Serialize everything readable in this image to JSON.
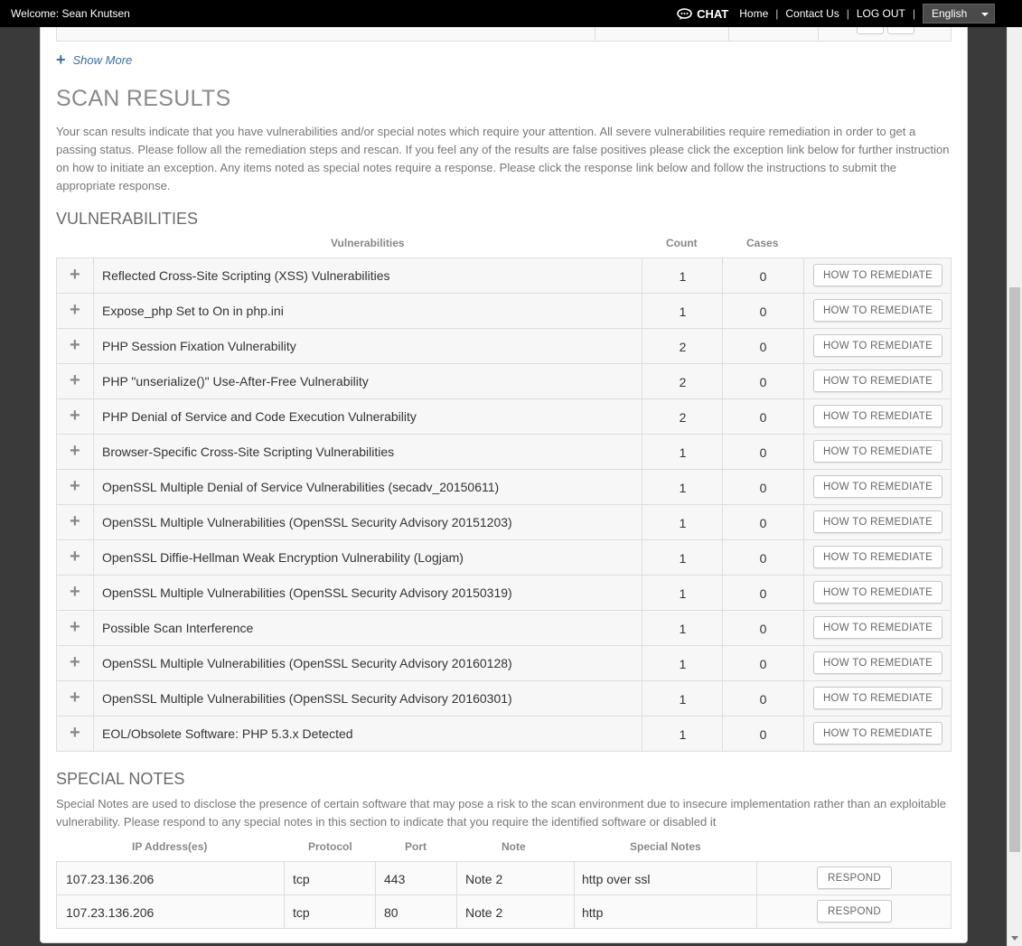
{
  "topbar": {
    "welcome": "Welcome: Sean Knutsen",
    "chat_label": "CHAT",
    "nav": {
      "home": "Home",
      "contact": "Contact Us",
      "logout": "LOG OUT",
      "separator": "|"
    },
    "language": "English"
  },
  "show_more": "Show More",
  "scan_results": {
    "title": "SCAN RESULTS",
    "description": "Your scan results indicate that you have vulnerabilities and/or special notes which require your attention. All severe vulnerabilities require remediation in order to get a passing status. Please follow all the remediation steps and rescan. If you feel any of the results are false positives please click the exception link below for further instruction on how to initiate an exception. Any items noted as special notes require a response. Please click the response link below and follow the instructions to submit the appropriate response."
  },
  "vulnerabilities": {
    "title": "VULNERABILITIES",
    "headers": {
      "name": "Vulnerabilities",
      "count": "Count",
      "cases": "Cases"
    },
    "button_label": "HOW TO REMEDIATE",
    "expand_glyph": "+",
    "rows": [
      {
        "name": "Reflected Cross-Site Scripting (XSS) Vulnerabilities",
        "count": "1",
        "cases": "0"
      },
      {
        "name": "Expose_php Set to On in php.ini",
        "count": "1",
        "cases": "0"
      },
      {
        "name": "PHP Session Fixation Vulnerability",
        "count": "2",
        "cases": "0"
      },
      {
        "name": "PHP \"unserialize()\" Use-After-Free Vulnerability",
        "count": "2",
        "cases": "0"
      },
      {
        "name": "PHP Denial of Service and Code Execution Vulnerability",
        "count": "2",
        "cases": "0"
      },
      {
        "name": "Browser-Specific Cross-Site Scripting Vulnerabilities",
        "count": "1",
        "cases": "0"
      },
      {
        "name": "OpenSSL Multiple Denial of Service Vulnerabilities (secadv_20150611)",
        "count": "1",
        "cases": "0"
      },
      {
        "name": "OpenSSL Multiple Vulnerabilities (OpenSSL Security Advisory 20151203)",
        "count": "1",
        "cases": "0"
      },
      {
        "name": "OpenSSL Diffie-Hellman Weak Encryption Vulnerability (Logjam)",
        "count": "1",
        "cases": "0"
      },
      {
        "name": "OpenSSL Multiple Vulnerabilities (OpenSSL Security Advisory 20150319)",
        "count": "1",
        "cases": "0"
      },
      {
        "name": "Possible Scan Interference",
        "count": "1",
        "cases": "0"
      },
      {
        "name": "OpenSSL Multiple Vulnerabilities (OpenSSL Security Advisory 20160128)",
        "count": "1",
        "cases": "0"
      },
      {
        "name": "OpenSSL Multiple Vulnerabilities (OpenSSL Security Advisory 20160301)",
        "count": "1",
        "cases": "0"
      },
      {
        "name": "EOL/Obsolete Software: PHP 5.3.x Detected",
        "count": "1",
        "cases": "0"
      }
    ]
  },
  "special_notes": {
    "title": "SPECIAL NOTES",
    "description": "Special Notes are used to disclose the presence of certain software that may pose a risk to the scan environment due to insecure implementation rather than an exploitable vulnerability. Please respond to any special notes in this section to indicate that you require the identified software or disabled it",
    "headers": {
      "ip": "IP Address(es)",
      "protocol": "Protocol",
      "port": "Port",
      "note": "Note",
      "special": "Special Notes"
    },
    "button_label": "RESPOND",
    "rows": [
      {
        "ip": "107.23.136.206",
        "protocol": "tcp",
        "port": "443",
        "note": "Note 2",
        "special": "http over ssl"
      },
      {
        "ip": "107.23.136.206",
        "protocol": "tcp",
        "port": "80",
        "note": "Note 2",
        "special": "http"
      }
    ]
  },
  "colors": {
    "topbar": "#000000",
    "link": "#3b6fa8",
    "row_background": "#f7f7f7"
  }
}
